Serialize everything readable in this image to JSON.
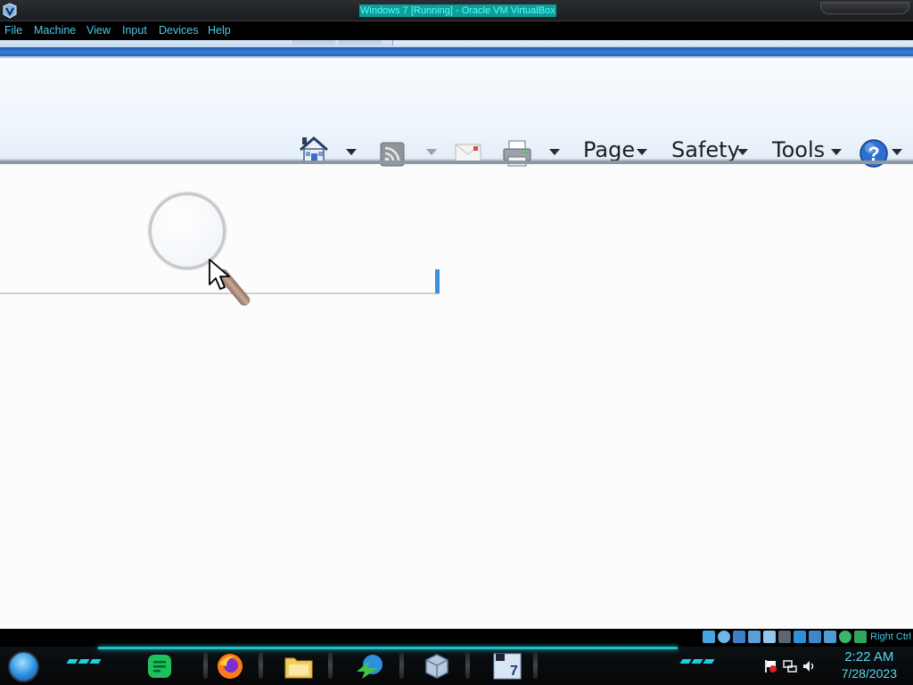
{
  "window": {
    "title": "Windows 7 [Running] - Oracle VM VirtualBox",
    "icon": "virtualbox-logo-icon"
  },
  "menubar": {
    "items": [
      {
        "label": "File"
      },
      {
        "label": "Machine"
      },
      {
        "label": "View"
      },
      {
        "label": "Input"
      },
      {
        "label": "Devices"
      },
      {
        "label": "Help"
      }
    ]
  },
  "ie_command_bar": {
    "home_icon": "home-icon",
    "feeds_icon": "rss-feed-icon",
    "mail_icon": "read-mail-icon",
    "print_icon": "printer-icon",
    "page_label": "Page",
    "safety_label": "Safety",
    "tools_label": "Tools",
    "help_icon": "help-icon"
  },
  "host_status": {
    "host_key": "Right Ctrl"
  },
  "taskbar": {
    "start_icon": "start-orb-icon",
    "apps": [
      {
        "name": "notes-app-icon"
      },
      {
        "name": "firefox-icon"
      },
      {
        "name": "file-explorer-icon"
      },
      {
        "name": "download-manager-icon"
      },
      {
        "name": "virtualbox-icon"
      },
      {
        "name": "windows7-vm-icon"
      }
    ],
    "clock": {
      "time": "2:22 AM",
      "date": "7/28/2023"
    }
  },
  "colors": {
    "menu_text": "#4fc8e8",
    "accent_cyan": "#19c2cc",
    "ie_blue": "#1e5ab0"
  }
}
